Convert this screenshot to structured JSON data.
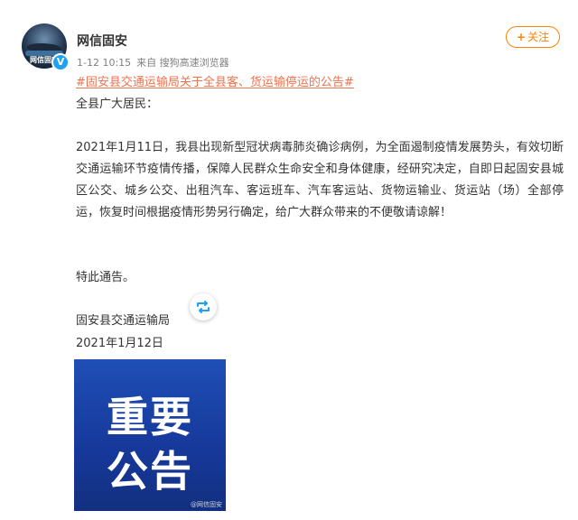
{
  "author": {
    "name": "网信固安",
    "avatar_text": "网信固安",
    "verified_mark": "V"
  },
  "meta": {
    "time": "1-12 10:15",
    "source": "来自 搜狗高速浏览器"
  },
  "follow": {
    "plus": "+",
    "label": "关注"
  },
  "post": {
    "topic": "#固安县交通运输局关于全县客、货运输停运的公告#",
    "greeting": "全县广大居民：",
    "body": "2021年1月11日，我县出现新型冠状病毒肺炎确诊病例，为全面遏制疫情发展势头，有效切断交通运输环节疫情传播，保障人民群众生命安全和身体健康，经研究决定，自即日起固安县城区公交、城乡公交、出租汽车、客运班车、汽车客运站、货物运输业、货运站（场）全部停运，恢复时间根据疫情形势另行确定，给广大群众带来的不便敬请谅解！",
    "closing": "特此通告。",
    "signature": "固安县交通运输局",
    "date": "2021年1月12日"
  },
  "image": {
    "line1": "重要",
    "line2": "公告",
    "watermark": "@网信固安"
  },
  "colors": {
    "accent": "#ff8200",
    "topic": "#eb7350",
    "verified": "#1da1f2",
    "image_bg": "#1f4fb5"
  }
}
